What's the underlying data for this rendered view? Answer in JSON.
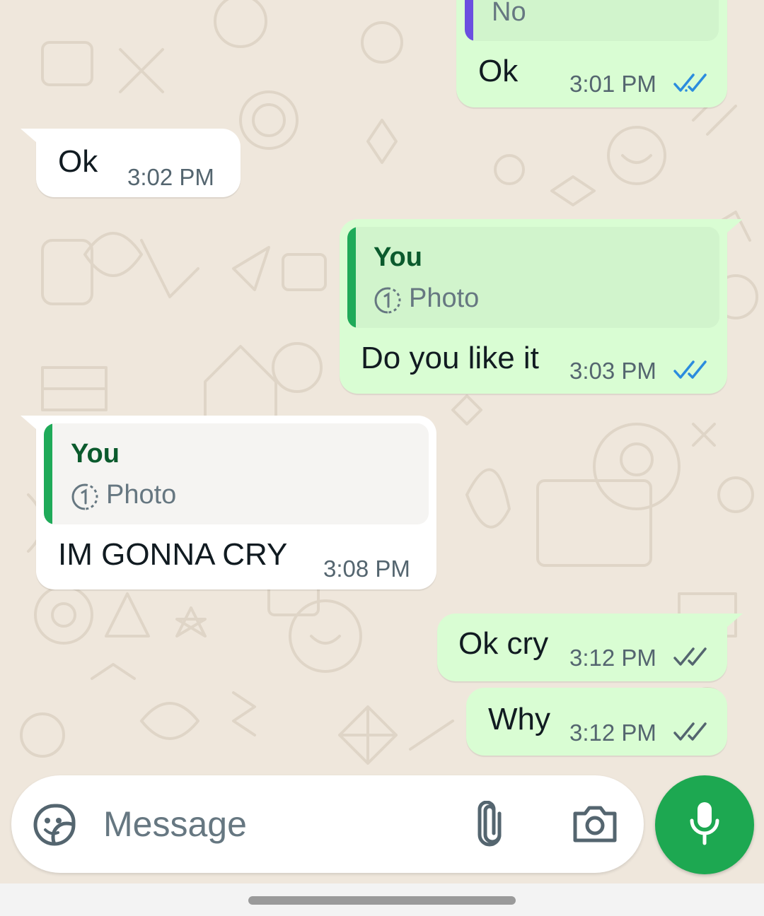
{
  "colors": {
    "outgoing_bubble": "#d9fdd3",
    "incoming_bubble": "#ffffff",
    "quote_bar_green": "#1faa59",
    "quote_bar_purple": "#6b4fe0",
    "read_ticks": "#2b8cde",
    "delivered_ticks": "#54656f",
    "mic_button": "#1da851"
  },
  "messages": [
    {
      "direction": "outgoing",
      "quote": {
        "title": "No"
      },
      "text": "Ok",
      "time": "3:01 PM",
      "status": "read"
    },
    {
      "direction": "incoming",
      "text": "Ok",
      "time": "3:02 PM"
    },
    {
      "direction": "outgoing",
      "quote": {
        "author": "You",
        "label": "Photo",
        "icon": "view-once-icon"
      },
      "text": "Do you like it",
      "time": "3:03 PM",
      "status": "read"
    },
    {
      "direction": "incoming",
      "quote": {
        "author": "You",
        "label": "Photo",
        "icon": "view-once-icon"
      },
      "text": "IM GONNA CRY",
      "time": "3:08 PM"
    },
    {
      "direction": "outgoing",
      "text": "Ok cry",
      "time": "3:12 PM",
      "status": "delivered"
    },
    {
      "direction": "outgoing",
      "text": "Why",
      "time": "3:12 PM",
      "status": "delivered"
    }
  ],
  "composer": {
    "placeholder": "Message",
    "icons": [
      "sticker-icon",
      "attach-icon",
      "camera-icon",
      "mic-icon"
    ]
  }
}
